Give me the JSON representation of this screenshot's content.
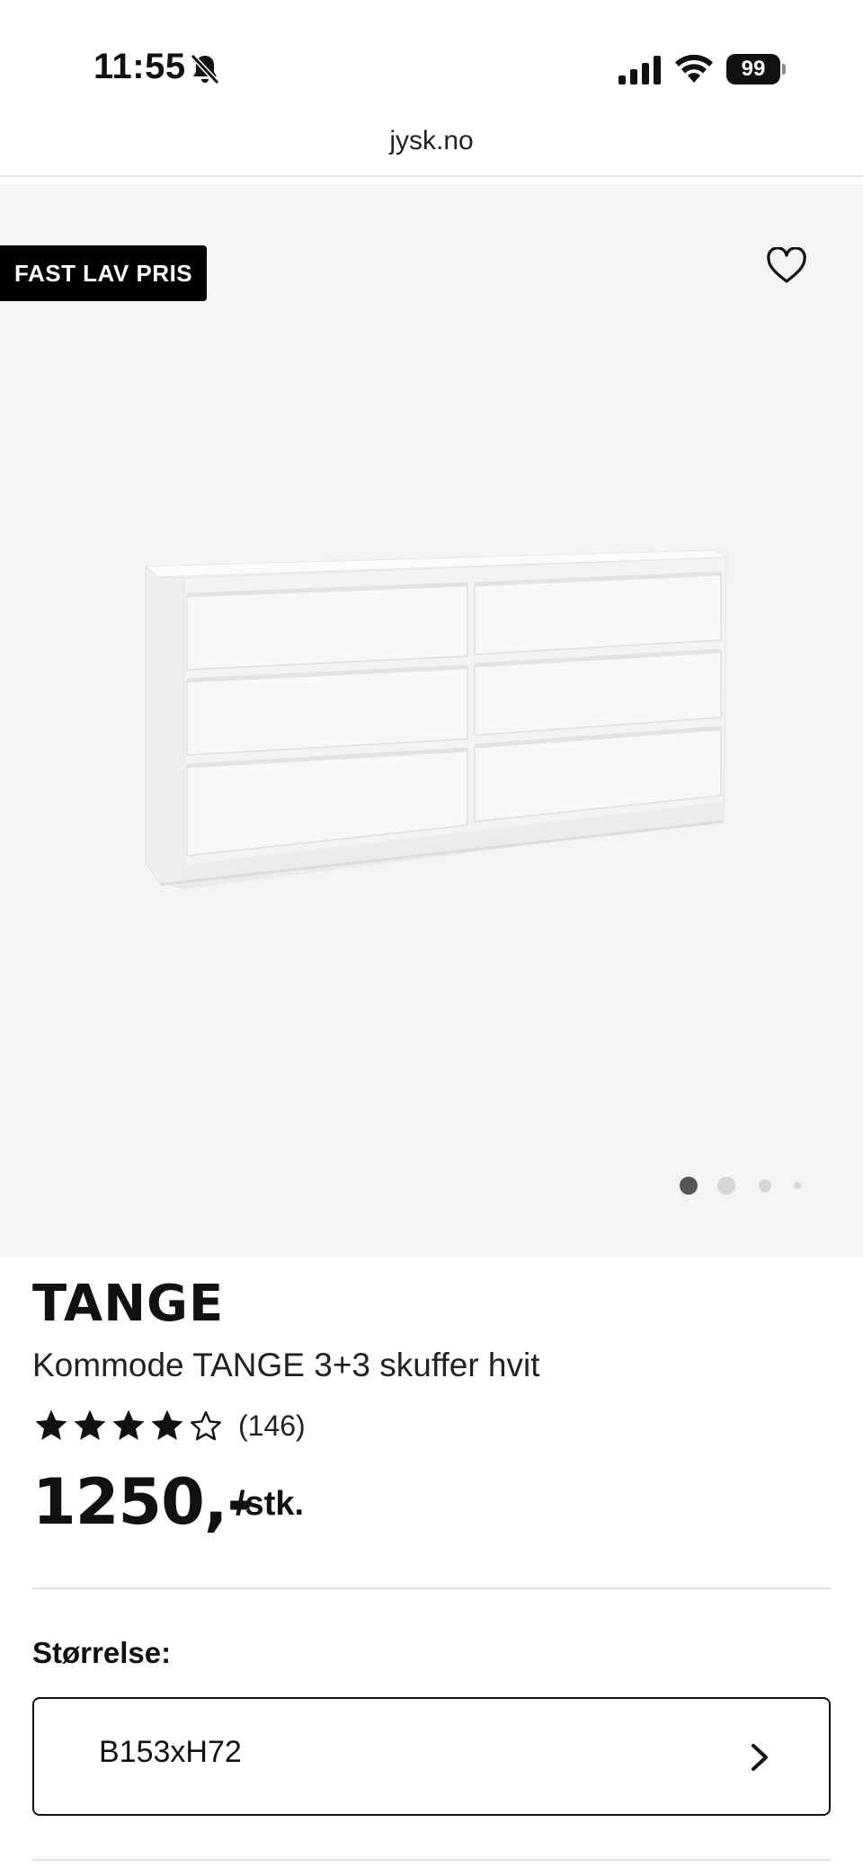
{
  "status_bar": {
    "time": "11:55",
    "battery": "99",
    "icons": [
      "bell-slash-icon",
      "signal-icon",
      "wifi-icon",
      "battery-icon"
    ]
  },
  "browser": {
    "url": "jysk.no"
  },
  "hero": {
    "badge": "FAST LAV PRIS",
    "favorite_icon": "heart-outline-icon",
    "image": "white-dresser-6-drawers",
    "carousel": {
      "count": 4,
      "active": 0
    },
    "background": "#f4f4f4"
  },
  "product": {
    "brand": "TANGE",
    "description": "Kommode TANGE 3+3 skuffer hvit",
    "rating": {
      "value": 4,
      "max": 5,
      "count": "(146)"
    },
    "price": "1250,-",
    "unit": "/stk."
  },
  "size": {
    "label": "Størrelse:",
    "value": "B153xH72"
  },
  "colors": {
    "text": "#111111",
    "badge": "#000000",
    "divider": "#e1e1e1"
  }
}
